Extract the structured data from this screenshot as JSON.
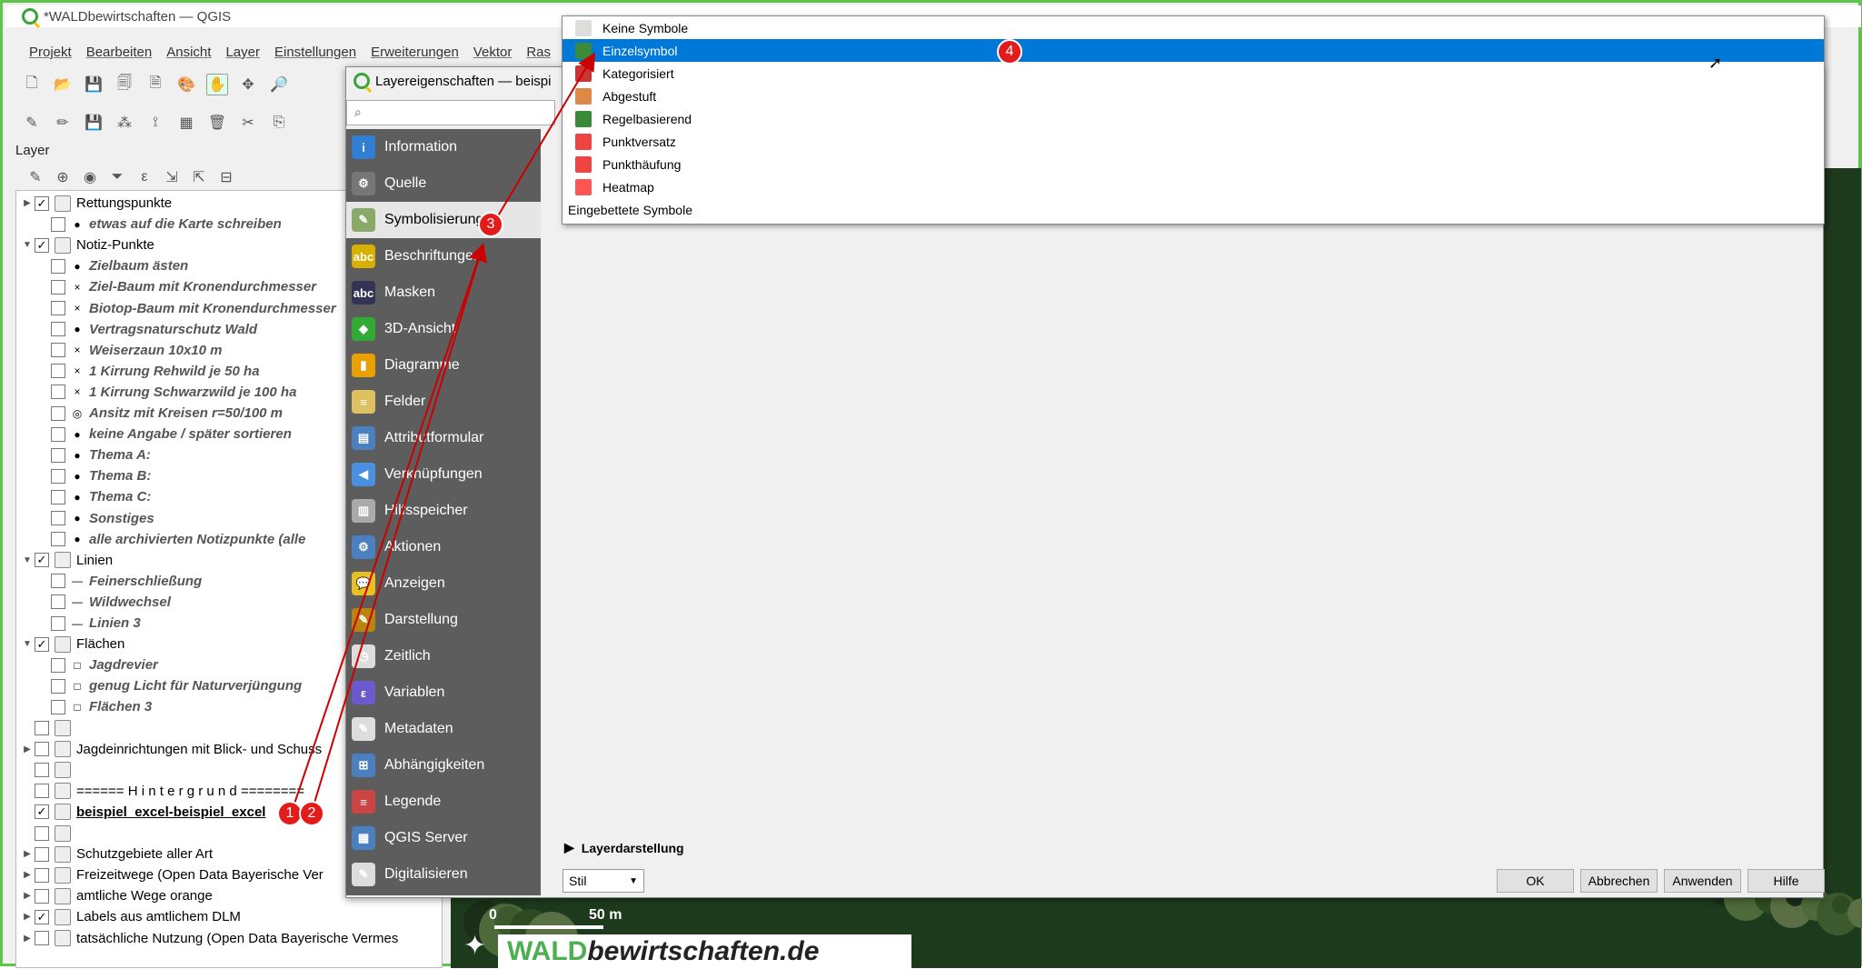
{
  "window": {
    "title": "*WALDbewirtschaften — QGIS"
  },
  "menu": [
    "Projekt",
    "Bearbeiten",
    "Ansicht",
    "Layer",
    "Einstellungen",
    "Erweiterungen",
    "Vektor",
    "Ras"
  ],
  "layers": {
    "header": "Layer",
    "rows": [
      {
        "label": "Rettungspunkte",
        "checked": "✓",
        "group": true,
        "exp": "▶"
      },
      {
        "label": "etwas auf die Karte schreiben",
        "checked": "",
        "style": "it",
        "sym": "●"
      },
      {
        "label": "Notiz-Punkte",
        "checked": "✓",
        "group": true,
        "exp": "▼"
      },
      {
        "label": "Zielbaum ästen",
        "style": "it",
        "sym": "●"
      },
      {
        "label": "Ziel-Baum mit Kronendurchmesser",
        "style": "it",
        "sym": "×"
      },
      {
        "label": "Biotop-Baum mit Kronendurchmesser",
        "style": "it",
        "sym": "×"
      },
      {
        "label": "Vertragsnaturschutz Wald",
        "style": "it",
        "sym": "●"
      },
      {
        "label": "Weiserzaun 10x10  m",
        "style": "it",
        "sym": "×"
      },
      {
        "label": "1 Kirrung Rehwild je 50 ha",
        "style": "it",
        "sym": "×"
      },
      {
        "label": "1 Kirrung Schwarzwild je 100 ha",
        "style": "it",
        "sym": "×"
      },
      {
        "label": "Ansitz mit Kreisen r=50/100 m",
        "style": "it",
        "sym": "◎"
      },
      {
        "label": "keine Angabe / später sortieren",
        "style": "it",
        "sym": "●"
      },
      {
        "label": "Thema A:",
        "style": "it",
        "sym": "●"
      },
      {
        "label": "Thema B:",
        "style": "it",
        "sym": "●"
      },
      {
        "label": "Thema C:",
        "style": "it",
        "sym": "●"
      },
      {
        "label": "Sonstiges",
        "style": "it",
        "sym": "●"
      },
      {
        "label": "alle archivierten Notizpunkte (alle",
        "style": "it",
        "sym": "●"
      },
      {
        "label": "Linien",
        "checked": "✓",
        "group": true,
        "exp": "▼"
      },
      {
        "label": "Feinerschließung",
        "style": "it",
        "sym": "—"
      },
      {
        "label": "Wildwechsel",
        "style": "it",
        "sym": "—"
      },
      {
        "label": "Linien 3",
        "style": "it",
        "sym": "—"
      },
      {
        "label": "Flächen",
        "checked": "✓",
        "group": true,
        "exp": "▼"
      },
      {
        "label": "Jagdrevier",
        "style": "it",
        "sym": "□"
      },
      {
        "label": "genug Licht für Naturverjüngung",
        "style": "it",
        "sym": "□"
      },
      {
        "label": "Flächen 3",
        "style": "it",
        "sym": "□"
      },
      {
        "label": "",
        "group": true
      },
      {
        "label": "Jagdeinrichtungen mit Blick- und Schuss",
        "group": true,
        "exp": "▶"
      },
      {
        "label": "",
        "group": true
      },
      {
        "label": "====== H i n t e r g r u n d ========",
        "group": true
      },
      {
        "label": "beispiel_excel-beispiel_excel",
        "checked": "✓",
        "group": true,
        "bold": true
      },
      {
        "label": "",
        "group": true
      },
      {
        "label": "Schutzgebiete aller Art",
        "group": true,
        "exp": "▶"
      },
      {
        "label": "Freizeitwege (Open Data Bayerische Ver",
        "group": true,
        "exp": "▶"
      },
      {
        "label": "amtliche Wege orange",
        "group": true,
        "exp": "▶"
      },
      {
        "label": "Labels aus amtlichem DLM",
        "checked": "✓",
        "group": true,
        "exp": "▶"
      },
      {
        "label": "tatsächliche Nutzung  (Open Data Bayerische Vermes",
        "group": true,
        "exp": "▶"
      }
    ]
  },
  "dialog": {
    "title": "Layereigenschaften — beispi",
    "categories": [
      {
        "label": "Information",
        "color": "#2f7fd5",
        "g": "i"
      },
      {
        "label": "Quelle",
        "color": "#777",
        "g": "⚙"
      },
      {
        "label": "Symbolisierung",
        "color": "#8a6",
        "g": "✎",
        "sel": true
      },
      {
        "label": "Beschriftungen",
        "color": "#d8b000",
        "g": "abc"
      },
      {
        "label": "Masken",
        "color": "#335",
        "g": "abc"
      },
      {
        "label": "3D-Ansicht",
        "color": "#3a3",
        "g": "◆"
      },
      {
        "label": "Diagramme",
        "color": "#e9a000",
        "g": "▮"
      },
      {
        "label": "Felder",
        "color": "#ddc060",
        "g": "≡"
      },
      {
        "label": "Attributformular",
        "color": "#4a7fc0",
        "g": "▤"
      },
      {
        "label": "Verknüpfungen",
        "color": "#4a90e2",
        "g": "◀"
      },
      {
        "label": "Hilfsspeicher",
        "color": "#aaa",
        "g": "▥"
      },
      {
        "label": "Aktionen",
        "color": "#4a7fc0",
        "g": "⚙"
      },
      {
        "label": "Anzeigen",
        "color": "#e8c020",
        "g": "💬"
      },
      {
        "label": "Darstellung",
        "color": "#b8860b",
        "g": "✎"
      },
      {
        "label": "Zeitlich",
        "color": "#ddd",
        "g": "◷"
      },
      {
        "label": "Variablen",
        "color": "#6a5acd",
        "g": "ε"
      },
      {
        "label": "Metadaten",
        "color": "#ddd",
        "g": "✎"
      },
      {
        "label": "Abhängigkeiten",
        "color": "#4a7fc0",
        "g": "⊞"
      },
      {
        "label": "Legende",
        "color": "#c44",
        "g": "≡"
      },
      {
        "label": "QGIS Server",
        "color": "#4a7fc0",
        "g": "▦"
      },
      {
        "label": "Digitalisieren",
        "color": "#ddd",
        "g": "✎"
      }
    ],
    "renderers": [
      {
        "label": "Keine Symbole",
        "icon": "#ddd"
      },
      {
        "label": "Einzelsymbol",
        "icon": "#3a8a3a",
        "sel": true
      },
      {
        "label": "Kategorisiert",
        "icon": "#c33"
      },
      {
        "label": "Abgestuft",
        "icon": "#d84"
      },
      {
        "label": "Regelbasierend",
        "icon": "#3a8a3a"
      },
      {
        "label": "Punktversatz",
        "icon": "#e44"
      },
      {
        "label": "Punkthäufung",
        "icon": "#e44"
      },
      {
        "label": "Heatmap",
        "icon": "#f55"
      }
    ],
    "embedded": "Eingebettete Symbole",
    "layerdarstellung": "Layerdarstellung",
    "stil": "Stil",
    "buttons": {
      "ok": "OK",
      "cancel": "Abbrechen",
      "apply": "Anwenden",
      "help": "Hilfe"
    }
  },
  "scalebar": {
    "zero": "0",
    "max": "50 m"
  },
  "watermark": {
    "main": "WALD",
    "suffix": "bewirtschaften.de"
  },
  "badges": [
    "1",
    "2",
    "3",
    "4"
  ]
}
